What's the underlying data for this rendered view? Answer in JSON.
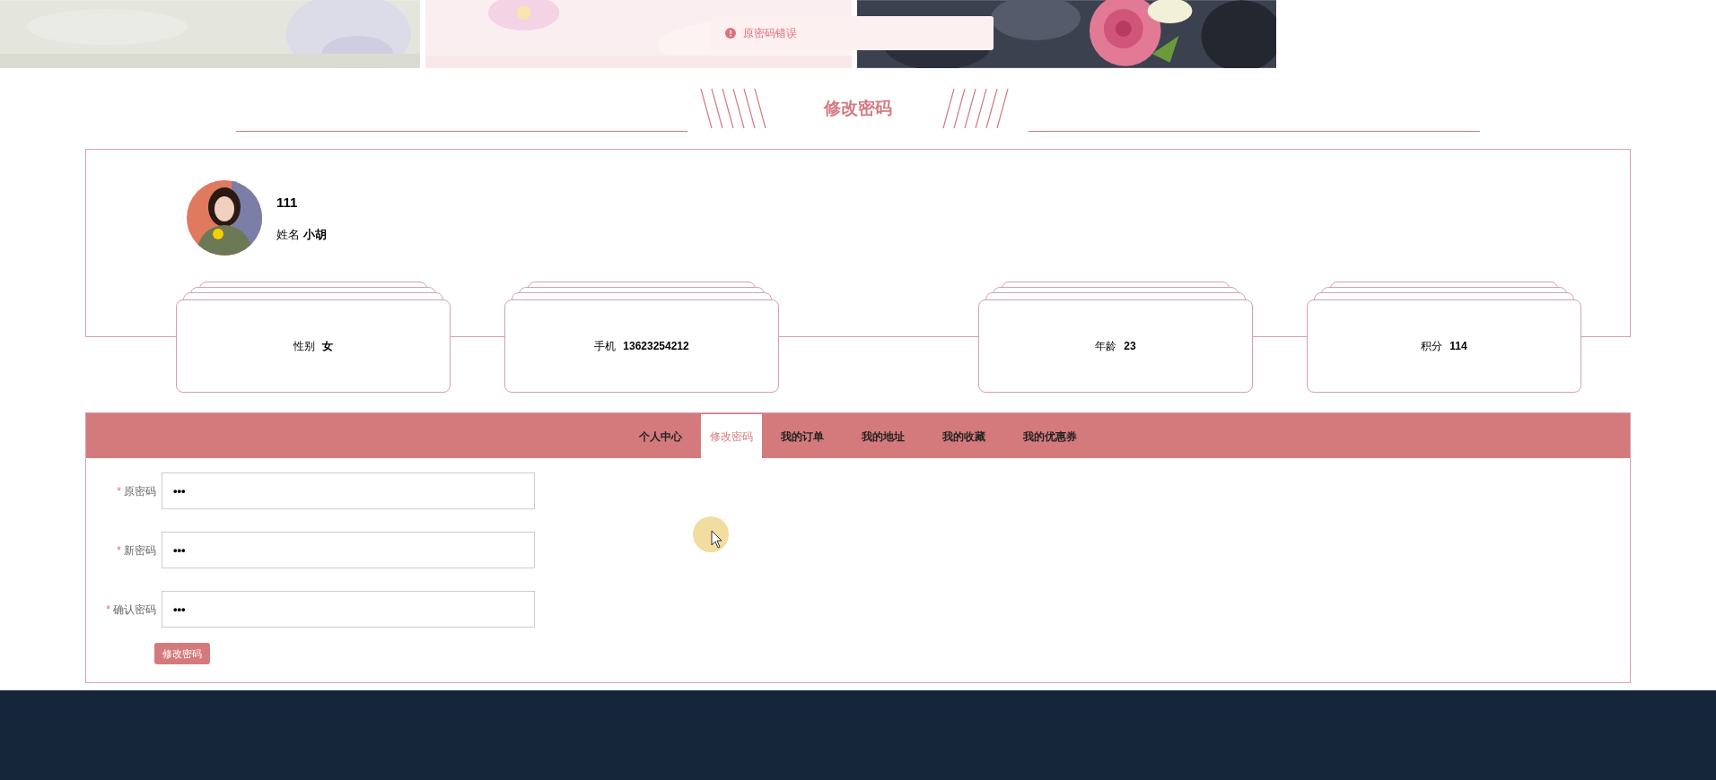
{
  "toast": {
    "text": "原密码错误"
  },
  "section_title": "修改密码",
  "profile": {
    "username": "111",
    "name_label": "姓名",
    "name": "小胡",
    "stats": [
      {
        "label": "性别",
        "value": "女"
      },
      {
        "label": "手机",
        "value": "13623254212"
      },
      {
        "label": "年龄",
        "value": "23"
      },
      {
        "label": "积分",
        "value": "114"
      }
    ]
  },
  "tabs": [
    {
      "label": "个人中心",
      "selected": false
    },
    {
      "label": "修改密码",
      "selected": true
    },
    {
      "label": "我的订单",
      "selected": false
    },
    {
      "label": "我的地址",
      "selected": false
    },
    {
      "label": "我的收藏",
      "selected": false
    },
    {
      "label": "我的优惠券",
      "selected": false
    }
  ],
  "form": {
    "fields": [
      {
        "label": "原密码",
        "required_mark": "*",
        "value": "•••"
      },
      {
        "label": "新密码",
        "required_mark": "*",
        "value": "•••"
      },
      {
        "label": "确认密码",
        "required_mark": "*",
        "value": "•••"
      }
    ],
    "submit": "修改密码"
  }
}
